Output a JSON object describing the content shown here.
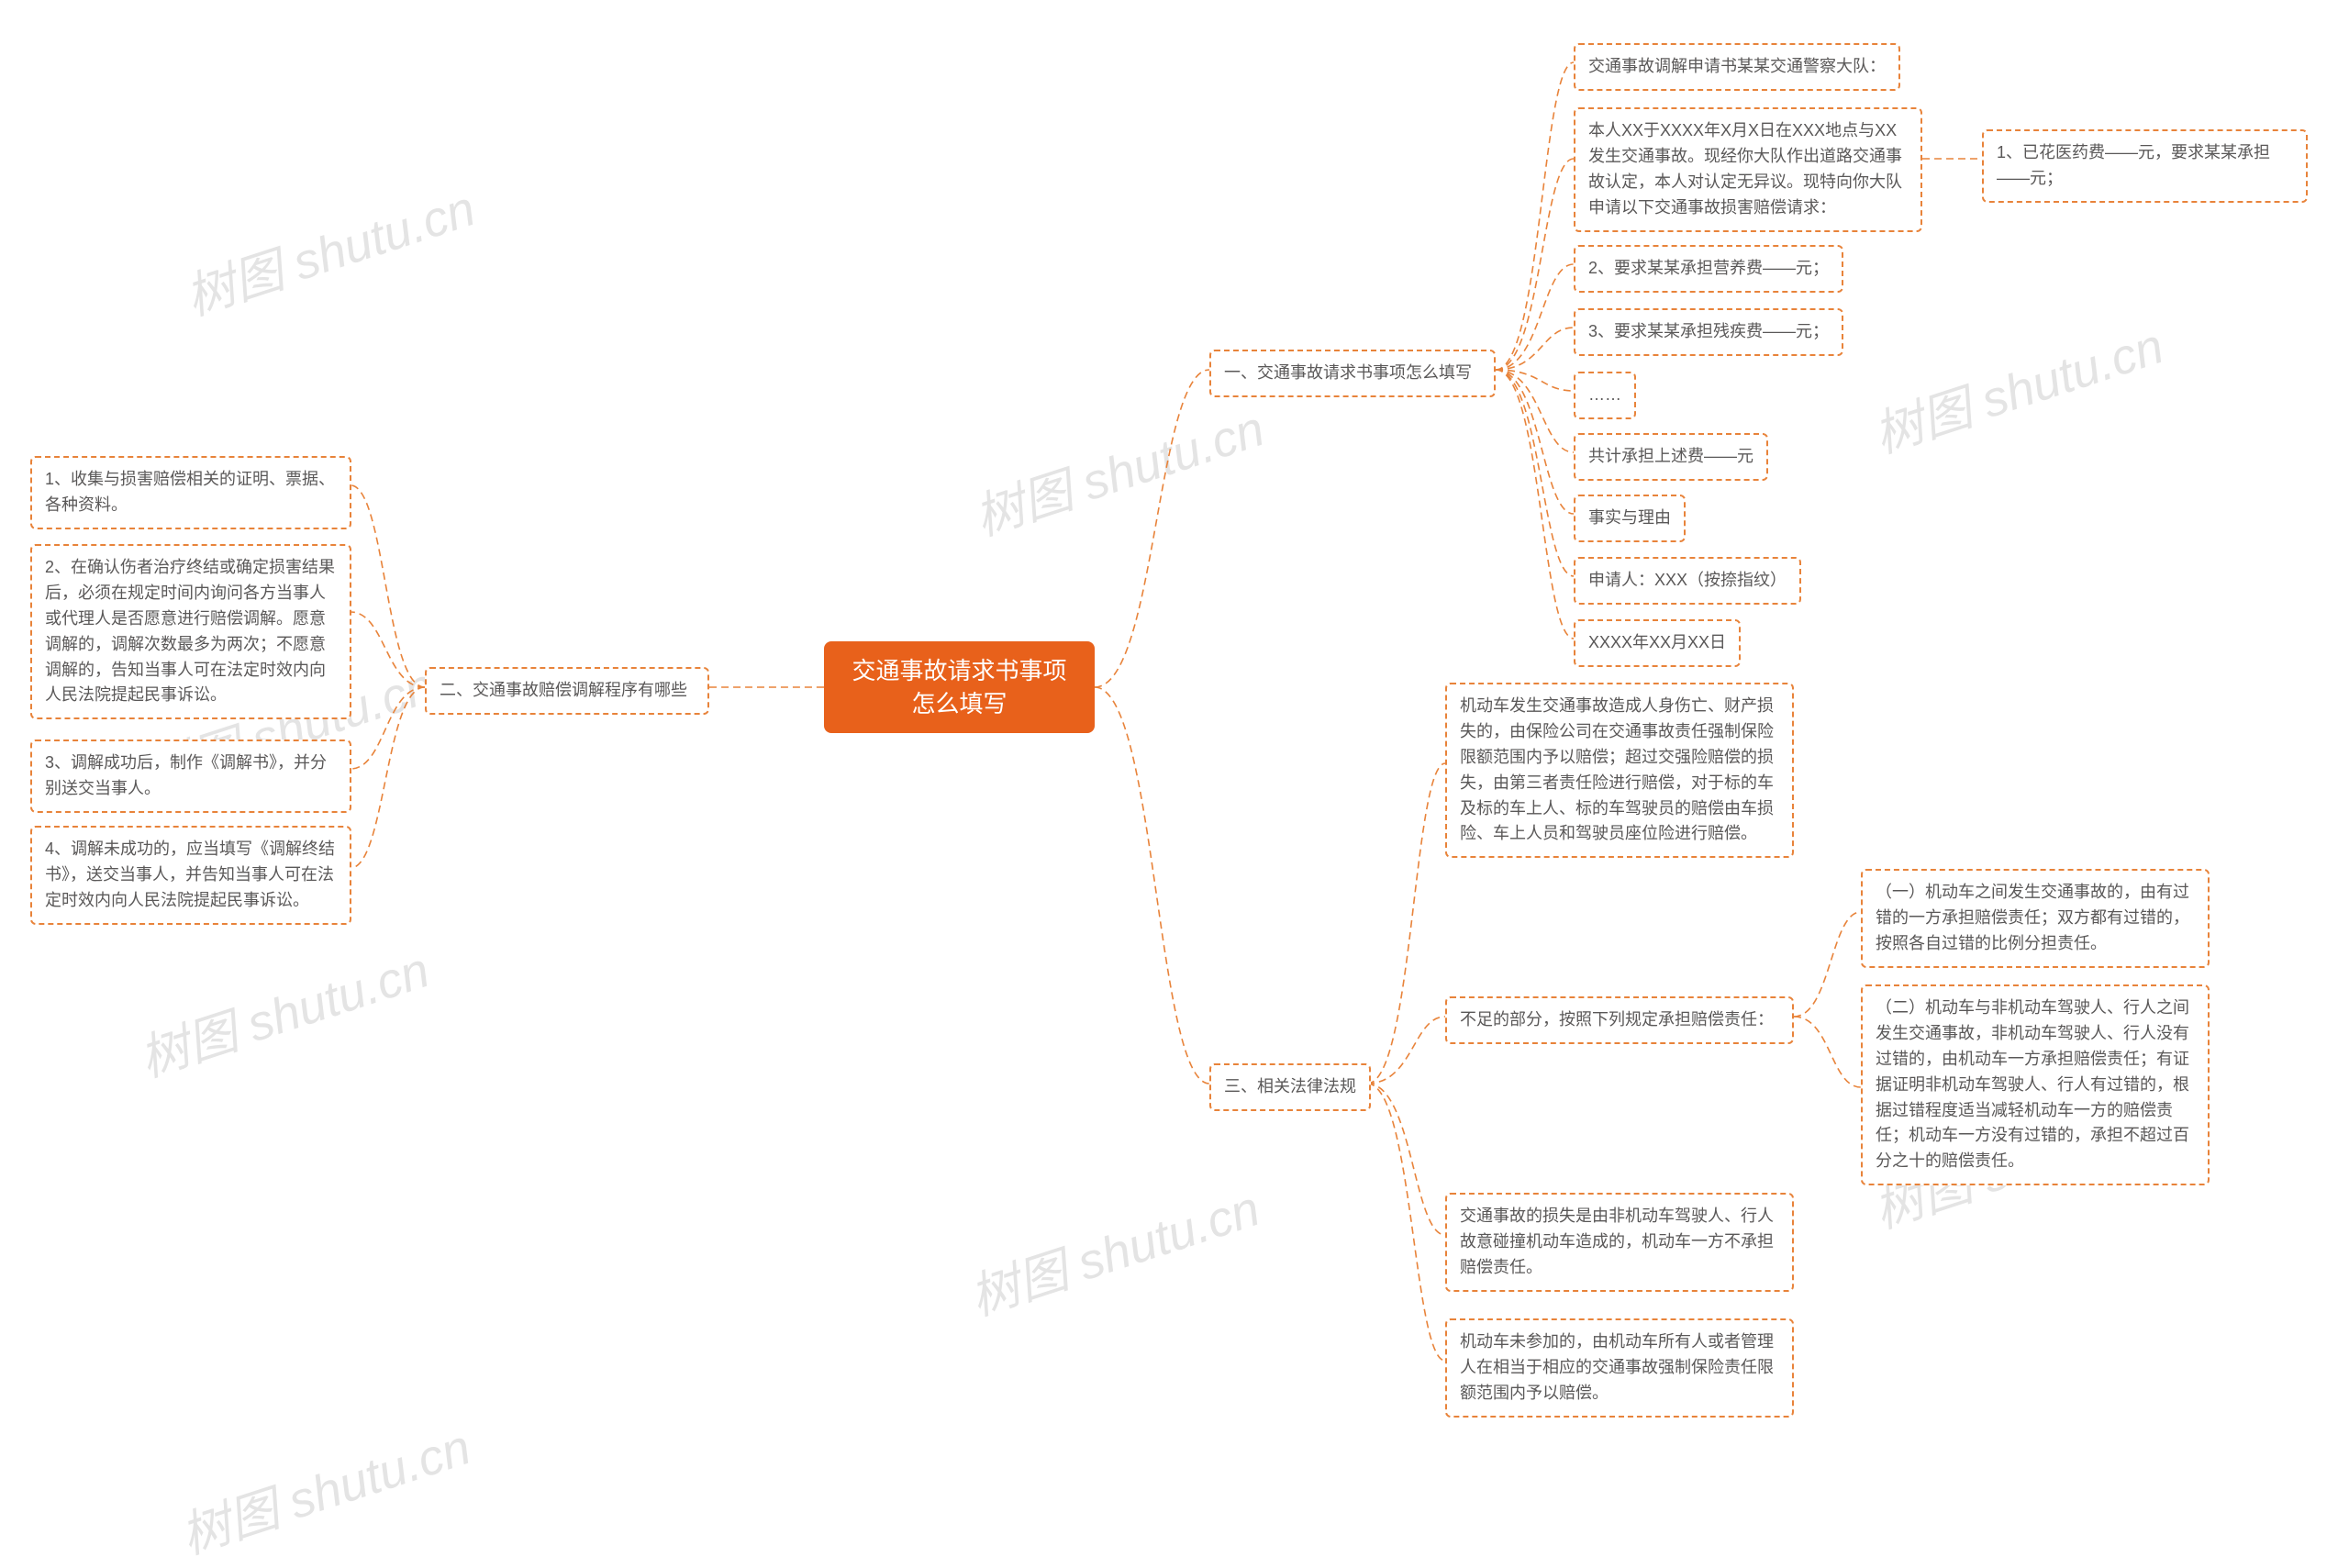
{
  "center": {
    "title": "交通事故请求书事项怎么填写"
  },
  "left": {
    "branch_title": "二、交通事故赔偿调解程序有哪些",
    "items": [
      "1、收集与损害赔偿相关的证明、票据、各种资料。",
      "2、在确认伤者治疗终结或确定损害结果后，必须在规定时间内询问各方当事人或代理人是否愿意进行赔偿调解。愿意调解的，调解次数最多为两次；不愿意调解的，告知当事人可在法定时效内向人民法院提起民事诉讼。",
      "3、调解成功后，制作《调解书》，并分别送交当事人。",
      "4、调解未成功的，应当填写《调解终结书》，送交当事人，并告知当事人可在法定时效内向人民法院提起民事诉讼。"
    ]
  },
  "right": {
    "branch1": {
      "title": "一、交通事故请求书事项怎么填写",
      "items": [
        "交通事故调解申请书某某交通警察大队：",
        "本人XX于XXXX年X月X日在XXX地点与XX发生交通事故。现经你大队作出道路交通事故认定，本人对认定无异议。现特向你大队申请以下交通事故损害赔偿请求：",
        "2、要求某某承担营养费——元；",
        "3、要求某某承担残疾费——元；",
        "……",
        "共计承担上述费——元",
        "事实与理由",
        "申请人：XXX（按捺指纹）",
        "XXXX年XX月XX日"
      ],
      "side": "1、已花医药费——元，要求某某承担——元；"
    },
    "branch3": {
      "title": "三、相关法律法规",
      "items": [
        "机动车发生交通事故造成人身伤亡、财产损失的，由保险公司在交通事故责任强制保险限额范围内予以赔偿；超过交强险赔偿的损失，由第三者责任险进行赔偿，对于标的车及标的车上人、标的车驾驶员的赔偿由车损险、车上人员和驾驶员座位险进行赔偿。",
        "交通事故的损失是由非机动车驾驶人、行人故意碰撞机动车造成的，机动车一方不承担赔偿责任。",
        "机动车未参加的，由机动车所有人或者管理人在相当于相应的交通事故强制保险责任限额范围内予以赔偿。"
      ],
      "sub": {
        "head": "不足的部分，按照下列规定承担赔偿责任：",
        "items": [
          "（一）机动车之间发生交通事故的，由有过错的一方承担赔偿责任；双方都有过错的，按照各自过错的比例分担责任。",
          "（二）机动车与非机动车驾驶人、行人之间发生交通事故，非机动车驾驶人、行人没有过错的，由机动车一方承担赔偿责任；有证据证明非机动车驾驶人、行人有过错的，根据过错程度适当减轻机动车一方的赔偿责任；机动车一方没有过错的，承担不超过百分之十的赔偿责任。"
        ]
      }
    }
  },
  "watermark": "树图 shutu.cn"
}
